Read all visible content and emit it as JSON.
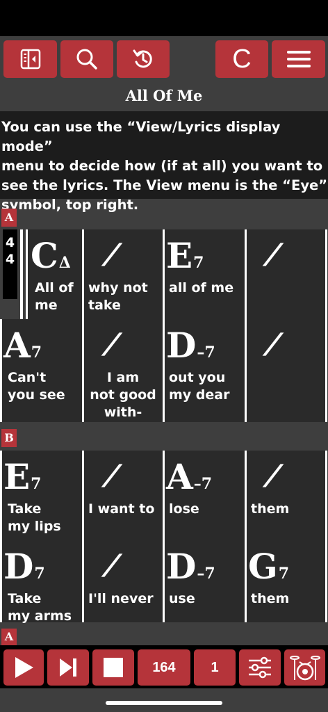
{
  "song": {
    "title": "All Of Me"
  },
  "note": {
    "text": "You can use the “View/Lyrics display mode”\nmenu to decide how (if at all) you want to\nsee the lyrics. The View menu is the “Eye”\nsymbol, top right."
  },
  "toolbar": {
    "buttons": [
      {
        "icon": "sidebar-toggle-icon"
      },
      {
        "icon": "search-icon"
      },
      {
        "icon": "undo-icon"
      },
      {
        "icon": "key-c-icon",
        "label": "C"
      },
      {
        "icon": "hamburger-menu-icon"
      }
    ]
  },
  "timesig": {
    "top": "4",
    "bottom": "4"
  },
  "sections": [
    "A",
    "B",
    "A"
  ],
  "repeat_symbol": "⁄",
  "rows": [
    {
      "cells": [
        {
          "root": "C",
          "ext": "Δ",
          "lyric": "All of\nme"
        },
        {
          "root": "",
          "ext": "",
          "repeat": true,
          "lyric": "why not\ntake"
        },
        {
          "root": "E",
          "ext": "7",
          "lyric": "all of me"
        },
        {
          "root": "",
          "ext": "",
          "repeat": true,
          "lyric": ""
        }
      ]
    },
    {
      "cells": [
        {
          "root": "A",
          "ext": "7",
          "lyric": "Can't\nyou see"
        },
        {
          "root": "",
          "ext": "",
          "repeat": true,
          "lyric": "I am\nnot good\nwith-"
        },
        {
          "root": "D",
          "ext": "–7",
          "lyric": "out you\nmy dear"
        },
        {
          "root": "",
          "ext": "",
          "repeat": true,
          "lyric": ""
        }
      ]
    },
    {
      "cells": [
        {
          "root": "E",
          "ext": "7",
          "lyric": "Take\nmy lips"
        },
        {
          "root": "",
          "ext": "",
          "repeat": true,
          "lyric": "I want to"
        },
        {
          "root": "A",
          "ext": "–7",
          "lyric": "lose"
        },
        {
          "root": "",
          "ext": "",
          "repeat": true,
          "lyric": "them"
        }
      ]
    },
    {
      "cells": [
        {
          "root": "D",
          "ext": "7",
          "lyric": "Take\nmy arms"
        },
        {
          "root": "",
          "ext": "",
          "repeat": true,
          "lyric": "I'll never"
        },
        {
          "root": "D",
          "ext": "–7",
          "lyric": "use"
        },
        {
          "root": "G",
          "ext": "7",
          "lyric": "them"
        }
      ]
    }
  ],
  "bottombar": {
    "tempo": "164",
    "count": "1",
    "icons": [
      "play-icon",
      "skip-next-icon",
      "stop-icon",
      "mixer-sliders-icon",
      "drumkit-icon"
    ]
  },
  "colors": {
    "accent": "#b5343a",
    "background": "#3e3e3e",
    "cell": "#2a2a2a"
  }
}
